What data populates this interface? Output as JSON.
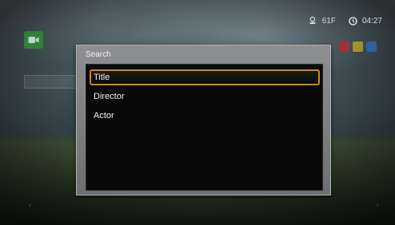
{
  "status": {
    "temperature": "61F",
    "time": "04:27",
    "weather_icon": "weather-icon",
    "clock_icon": "clock-icon"
  },
  "dialog": {
    "title": "Search",
    "options": [
      "Title",
      "Director",
      "Actor"
    ],
    "selected_option": "Title"
  },
  "colors": {
    "selection_border": "#c48a1e",
    "dialog_frame": "#7f8082",
    "dialog_body": "#090909",
    "app_icon": "#2f8a38",
    "color_button_red": "#c0282a",
    "color_button_yellow": "#c9b21e",
    "color_button_blue": "#2b6fc2"
  }
}
